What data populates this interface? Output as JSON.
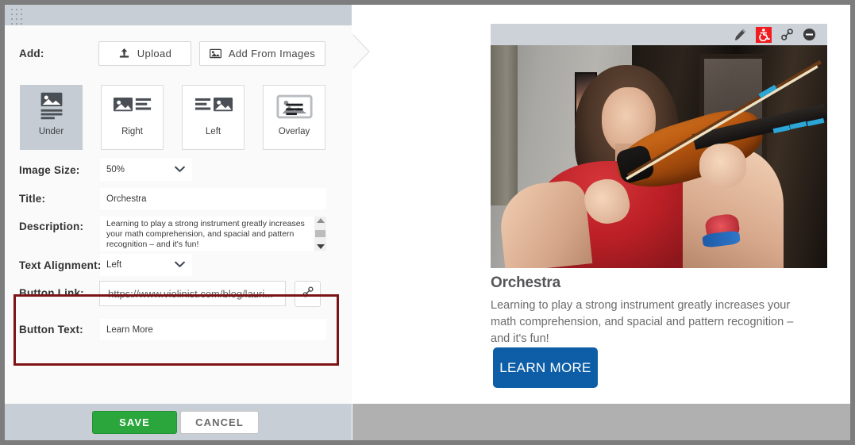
{
  "editor": {
    "add": {
      "label": "Add:",
      "upload_button": "Upload",
      "upload_icon": "upload-icon",
      "add_from_images_button": "Add From Images",
      "add_from_images_icon": "image-icon"
    },
    "layouts": {
      "selected": "Under",
      "options": [
        {
          "label": "Under",
          "icon": "layout-under-icon"
        },
        {
          "label": "Right",
          "icon": "layout-right-icon"
        },
        {
          "label": "Left",
          "icon": "layout-left-icon"
        },
        {
          "label": "Overlay",
          "icon": "layout-overlay-icon"
        }
      ]
    },
    "fields": {
      "image_size_label": "Image Size:",
      "image_size_value": "50%",
      "title_label": "Title:",
      "title_value": "Orchestra",
      "description_label": "Description:",
      "description_value": "Learning to play a strong instrument greatly increases your math comprehension, and spacial and pattern recognition – and it's fun!",
      "text_alignment_label": "Text Alignment:",
      "text_alignment_value": "Left",
      "button_link_label": "Button Link:",
      "button_link_value": "https://www.violinist.com/blog/lauri...",
      "button_link_icon": "chain-link-icon",
      "button_text_label": "Button Text:",
      "button_text_value": "Learn More"
    },
    "footer": {
      "save_label": "SAVE",
      "cancel_label": "CANCEL",
      "save_color": "#2aa63c"
    },
    "highlight_color": "#7c1316",
    "drag_handle_icon": "drag-handle-icon"
  },
  "preview": {
    "toolbar": [
      {
        "name": "edit-icon",
        "label": "Edit"
      },
      {
        "name": "accessibility-icon",
        "label": "Accessibility",
        "color": "#f01c20",
        "active": true
      },
      {
        "name": "link-icon",
        "label": "Link"
      },
      {
        "name": "remove-icon",
        "label": "Remove"
      }
    ],
    "image_alt": "Girl in red shirt playing a violin",
    "title": "Orchestra",
    "description": "Learning to play a strong instrument greatly increases your math comprehension, and spacial and pattern recognition – and it's fun!",
    "cta_label": "LEARN MORE",
    "cta_color": "#0d5ea6"
  }
}
